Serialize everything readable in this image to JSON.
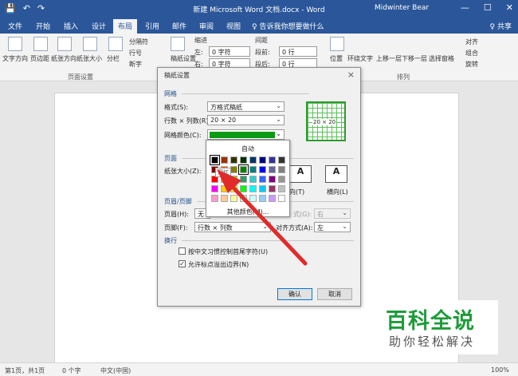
{
  "titlebar": {
    "title": "新建 Microsoft Word 文档.docx - Word",
    "user": "Midwinter Bear",
    "save_icon": "💾",
    "undo_icon": "↶",
    "redo_icon": "↷",
    "min": "—",
    "max": "☐",
    "close": "✕"
  },
  "tabs": [
    "文件",
    "开始",
    "插入",
    "设计",
    "布局",
    "引用",
    "邮件",
    "审阅",
    "视图"
  ],
  "tell_me": "♀ 告诉我你想要做什么",
  "share": "♀ 共享",
  "ribbon": {
    "text_dir": "文字方向",
    "margins": "页边距",
    "orientation": "纸张方向",
    "size": "纸张大小",
    "columns": "分栏",
    "breaks": "分隔符",
    "line_numbers": "行号",
    "hyphenation": "断字",
    "page_setup_group": "页面设置",
    "grid_btn": "稿纸设置",
    "indent": "缩进",
    "spacing": "间距",
    "left": "左:",
    "right": "右:",
    "before": "段前:",
    "after": "段后:",
    "left_val": "0 字符",
    "right_val": "0 字符",
    "before_val": "0 行",
    "after_val": "0 行",
    "position": "位置",
    "wrap": "环绕文字",
    "forward": "上移一层",
    "backward": "下移一层",
    "pane": "选择窗格",
    "align": "对齐",
    "group": "组合",
    "rotate": "旋转",
    "arrange_group": "排列"
  },
  "dialog": {
    "title": "稿纸设置",
    "sec_grid": "网格",
    "format_label": "格式(S):",
    "format_value": "方格式稿纸",
    "rowcol_label": "行数 × 列数(R):",
    "rowcol_value": "20 × 20",
    "color_label": "网格颜色(C):",
    "preview_text": "20 × 20",
    "sec_page": "页面",
    "paper_label": "纸张大小(Z):",
    "landscape": "横向(L)",
    "portrait_suffix": "向(T)",
    "sec_hf": "页眉/页脚",
    "header_label": "页眉(H):",
    "header_value": "无",
    "footer_label": "页脚(F):",
    "footer_value": "行数 × 列数",
    "align_label": "对齐方式(A):",
    "align_value": "左",
    "align2_label": "式(G):",
    "align2_value": "右",
    "sec_wrap": "换行",
    "opt1": "按中文习惯控制首尾字符(U)",
    "opt2": "允许标点溢出边界(N)",
    "ok": "确认",
    "cancel": "取消"
  },
  "popup": {
    "auto": "自动",
    "tooltip": "深红",
    "more": "其他颜色(M)..."
  },
  "palette": [
    [
      "#000000",
      "#993300",
      "#333300",
      "#003300",
      "#003366",
      "#000080",
      "#333399",
      "#333333"
    ],
    [
      "#800000",
      "#FF6600",
      "#808000",
      "#008000",
      "#008080",
      "#0000FF",
      "#666699",
      "#808080"
    ],
    [
      "#FF0000",
      "#FF9900",
      "#99CC00",
      "#339966",
      "#33CCCC",
      "#3366FF",
      "#800080",
      "#969696"
    ],
    [
      "#FF00FF",
      "#FFCC00",
      "#FFFF00",
      "#00FF00",
      "#00FFFF",
      "#00CCFF",
      "#993366",
      "#C0C0C0"
    ],
    [
      "#FF99CC",
      "#FFCC99",
      "#FFFF99",
      "#CCFFCC",
      "#CCFFFF",
      "#99CCFF",
      "#CC99FF",
      "#FFFFFF"
    ]
  ],
  "grid_color": "#0a9a14",
  "status": {
    "page": "第1页，共1页",
    "words": "0 个字",
    "lang": "中文(中国)",
    "zoom": "100%"
  },
  "watermark": {
    "line1": "百科全说",
    "line2": "助你轻松解决"
  }
}
